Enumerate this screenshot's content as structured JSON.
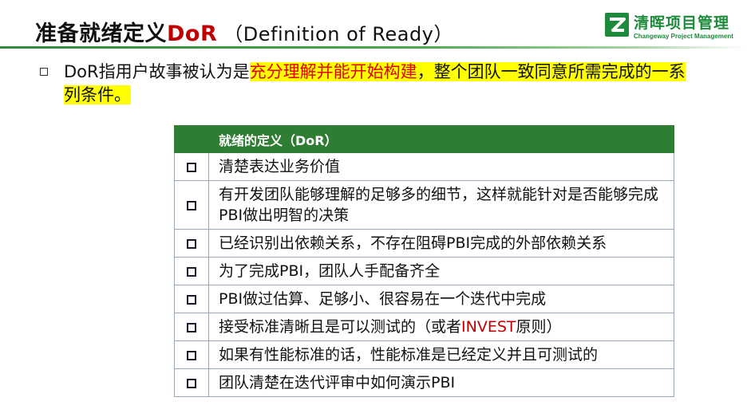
{
  "header": {
    "title_cn": "准备就绪定义",
    "title_acronym": "DoR",
    "title_paren": "（Definition of Ready）"
  },
  "logo": {
    "name_cn": "清晖项目管理",
    "name_en": "Changeway Project Management",
    "brand_color": "#1e8a3c"
  },
  "intro": {
    "part1": "DoR指用户故事被认为是",
    "part2": "充分理解并能开始构建",
    "part3": "，整个团队一致同意所需完成的一系列条件。"
  },
  "table": {
    "header": "就绪的定义（DoR）",
    "header_color": "#2e7d32",
    "rows": [
      {
        "text": "清楚表达业务价值"
      },
      {
        "text": "有开发团队能够理解的足够多的细节，这样就能针对是否能够完成PBI做出明智的决策"
      },
      {
        "text": "已经识别出依赖关系，不存在阻碍PBI完成的外部依赖关系"
      },
      {
        "text": "为了完成PBI，团队人手配备齐全"
      },
      {
        "text": "PBI做过估算、足够小、很容易在一个迭代中完成"
      },
      {
        "text_before": "接受标准清晰且是可以测试的（或者",
        "text_red": "INVEST",
        "text_after": "原则）"
      },
      {
        "text": "如果有性能标准的话，性能标准是已经定义并且可测试的"
      },
      {
        "text": "团队清楚在迭代评审中如何演示PBI"
      }
    ]
  }
}
